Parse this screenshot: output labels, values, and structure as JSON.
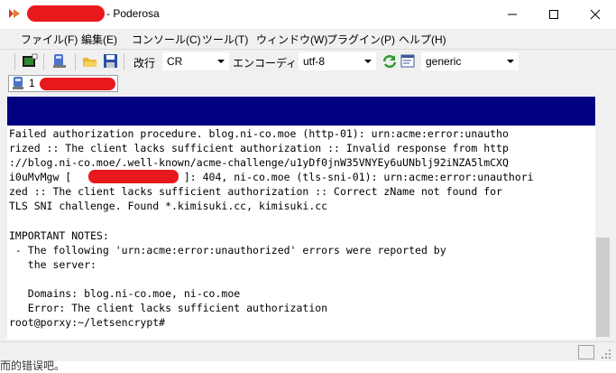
{
  "window": {
    "title": "- Poderosa"
  },
  "menu": {
    "items": [
      "ファイル(F)",
      "編集(E)",
      "コンソール(C)",
      "ツール(T)",
      "ウィンドウ(W)",
      "プラグイン(P)",
      "ヘルプ(H)"
    ]
  },
  "toolbar": {
    "newline_label": "改行",
    "newline_value": "CR",
    "encoding_label": "エンコーディング",
    "encoding_value": "utf-8",
    "terminal_type_value": "generic"
  },
  "tab": {
    "label": "1"
  },
  "terminal": {
    "lines": [
      "Failed authorization procedure. blog.ni-co.moe (http-01): urn:acme:error:unautho",
      "rized :: The client lacks sufficient authorization :: Invalid response from http",
      "://blog.ni-co.moe/.well-known/acme-challenge/u1yDf0jnW35VNYEy6uUNblj92iNZA5lmCXQ",
      "i0uMvMgw [                  ]: 404, ni-co.moe (tls-sni-01): urn:acme:error:unauthori",
      "zed :: The client lacks sufficient authorization :: Correct zName not found for",
      "TLS SNI challenge. Found *.kimisuki.cc, kimisuki.cc",
      "",
      "IMPORTANT NOTES:",
      " - The following 'urn:acme:error:unauthorized' errors were reported by",
      "   the server:",
      "",
      "   Domains: blog.ni-co.moe, ni-co.moe",
      "   Error: The client lacks sufficient authorization",
      "root@porxy:~/letsencrypt#"
    ]
  },
  "background": {
    "text": "而的错误吧。"
  },
  "colors": {
    "terminal_header": "#000080",
    "redaction": "#e8191c"
  }
}
